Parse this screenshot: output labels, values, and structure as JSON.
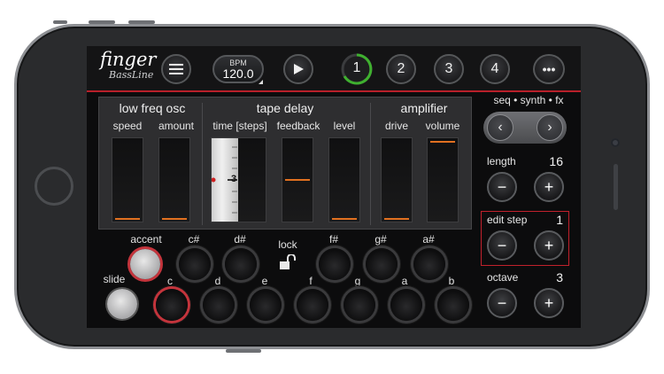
{
  "app": {
    "logo_main": "finger",
    "logo_sub": "BassLine"
  },
  "header": {
    "bpm_label": "BPM",
    "bpm_value": "120.0",
    "patterns": [
      "1",
      "2",
      "3",
      "4"
    ],
    "active_pattern": "1",
    "more_label": "•••"
  },
  "panel": {
    "lfo": {
      "title": "low freq osc",
      "speed": "speed",
      "amount": "amount"
    },
    "delay": {
      "title": "tape delay",
      "time": "time [steps]",
      "feedback": "feedback",
      "level": "level",
      "time_value": "3"
    },
    "amp": {
      "title": "amplifier",
      "drive": "drive",
      "volume": "volume"
    }
  },
  "right": {
    "mode_label": "seq • synth • fx",
    "length_label": "length",
    "length_value": "16",
    "edit_step_label": "edit step",
    "edit_step_value": "1",
    "octave_label": "octave",
    "octave_value": "3",
    "minus": "−",
    "plus": "+",
    "prev": "‹",
    "next": "›"
  },
  "keyboard": {
    "accent_label": "accent",
    "slide_label": "slide",
    "lock_label": "lock",
    "black_keys": [
      "c#",
      "d#",
      "f#",
      "g#",
      "a#"
    ],
    "white_keys": [
      "c",
      "d",
      "e",
      "f",
      "g",
      "a",
      "b"
    ]
  },
  "colors": {
    "accent_red": "#c1212c",
    "slider_marker": "#e07020"
  }
}
